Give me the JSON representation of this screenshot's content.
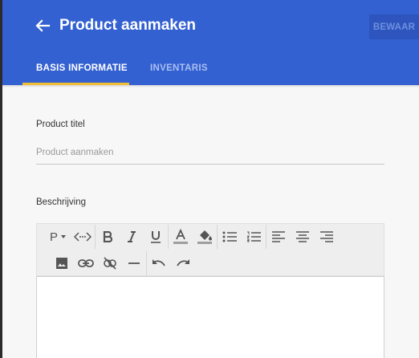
{
  "header": {
    "title": "Product aanmaken",
    "save_label": "BEWAAR",
    "back_icon": "arrow-left-icon",
    "bg_color": "#3461d1",
    "tab_indicator_color": "#f2be35"
  },
  "tabs": [
    {
      "label": "BASIS INFORMATIE",
      "active": true
    },
    {
      "label": "INVENTARIS",
      "active": false
    }
  ],
  "form": {
    "title_label": "Product titel",
    "title_value": "",
    "title_placeholder": "Product aanmaken",
    "description_label": "Beschrijving"
  },
  "editor_toolbar": {
    "paragraph_label": "P",
    "row1": [
      "paragraph-format-icon",
      "code-view-icon",
      "bold-icon",
      "italic-icon",
      "underline-icon",
      "text-color-icon",
      "background-color-icon",
      "bulleted-list-icon",
      "numbered-list-icon",
      "align-left-icon",
      "align-center-icon",
      "align-right-icon"
    ],
    "row2": [
      "insert-image-icon",
      "insert-link-icon",
      "remove-link-icon",
      "horizontal-line-icon",
      "undo-icon",
      "redo-icon"
    ]
  }
}
